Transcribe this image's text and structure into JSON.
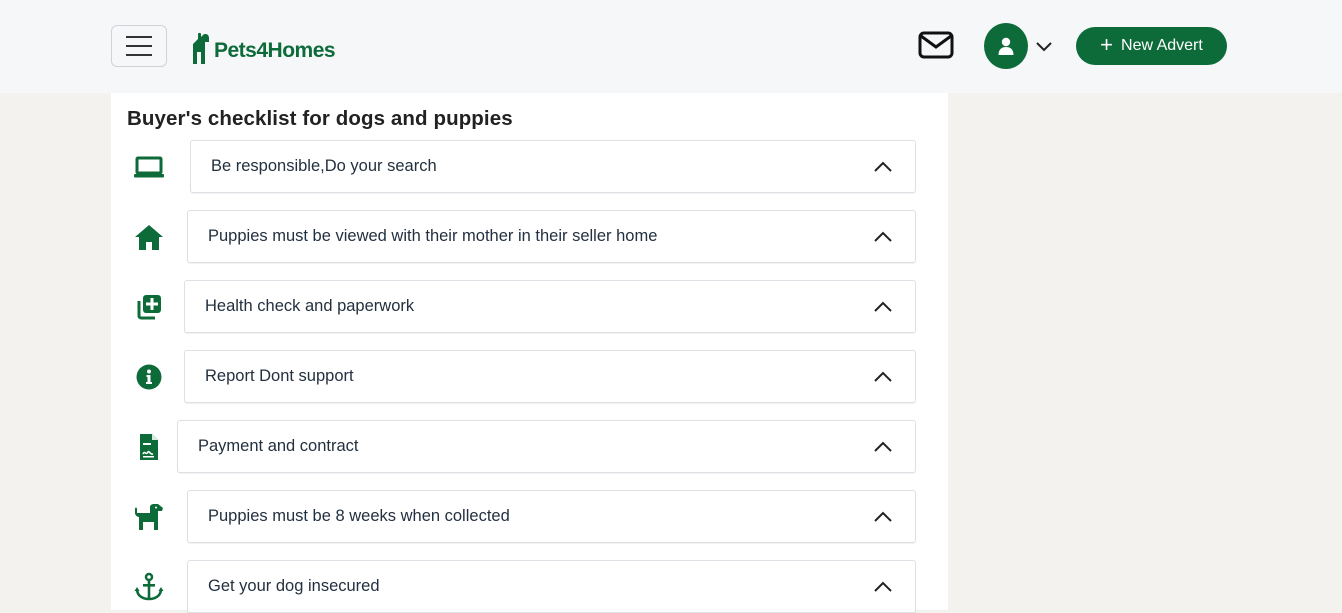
{
  "header": {
    "logo_text": "Pets4Homes",
    "new_advert_label": "New Advert"
  },
  "checklist": {
    "title": "Buyer's checklist for dogs and puppies",
    "items": [
      {
        "label": "Be responsible,Do your search",
        "icon": "laptop-icon"
      },
      {
        "label": "Puppies must be viewed with their mother in their seller home",
        "icon": "home-icon"
      },
      {
        "label": "Health check and paperwork",
        "icon": "medical-plus-icon"
      },
      {
        "label": "Report Dont support",
        "icon": "info-icon"
      },
      {
        "label": "Payment and contract",
        "icon": "contract-document-icon"
      },
      {
        "label": "Puppies must be 8 weeks when collected",
        "icon": "dog-icon"
      },
      {
        "label": "Get your dog insecured",
        "icon": "anchor-icon"
      }
    ]
  },
  "colors": {
    "brand_green": "#0d6b3a",
    "header_bg": "#f6f7f9",
    "page_bg": "#f3f2ee"
  }
}
